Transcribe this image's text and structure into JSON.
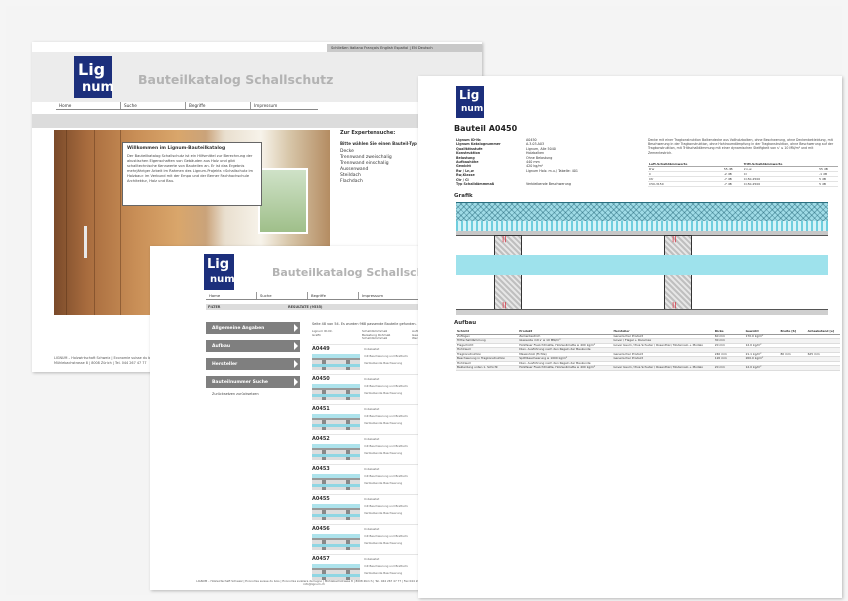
{
  "window_a": {
    "lang_bar": "Schließen   Italiano  Français  English  Español  |  EN  Deutsch",
    "title": "Bauteilkatalog Schallschutz",
    "nav": [
      "Home",
      "Suche",
      "Begriffe",
      "Impressum"
    ],
    "welcome_title": "Willkommen im Lignum-Bauteilkatalog",
    "welcome_body": "Der Bauteilkatalog Schallschutz ist ein Hilfsmittel zur Berechnung der akustischen Eigenschaften von Gebäuden aus Holz und gibt schalltechnische Kennwerte von Bauteilen an. Er ist das Ergebnis mehrjähriger Arbeit im Rahmen des Lignum-Projekts «Schallschutz im Holzbau» im Verbund mit der Empa und der Berner Fachhochschule Architektur, Holz und Bau.",
    "expert_title": "Zur Expertensuche:",
    "expert_prompt": "Bitte wählen Sie einen Bauteil-Typ aus:",
    "types": [
      "Decke",
      "Trennwand zweischalig",
      "Trennwand einschalig",
      "Aussenwand",
      "Steildach",
      "Flachdach"
    ],
    "footer": "LIGNUM – Holzwirtschaft Schweiz | Economie suisse du bois | Mühlebachstrasse 8 | 8008 Zürich | Tel. 044 267 47 77"
  },
  "window_b": {
    "title": "Bauteilkatalog Schallschutz",
    "nav": [
      "Home",
      "Suche",
      "Begriffe",
      "Impressum"
    ],
    "filter_label": "FILTER",
    "results_label": "RESULTATE (9535)",
    "side_buttons": [
      "Allgemeine Angaben",
      "Aufbau",
      "Hersteller",
      "Bauteilnummer Suche"
    ],
    "reset_link": "Zurücksetzen zurücksetzen",
    "results_caption": "Seite 48 von 54. Es wurden 968 passende Bauteile gefunden.",
    "col_heads": [
      "Lignum ID-Nr. Grafik",
      "Schalldämmmaß Belastung Rohmaß Schalldämmmaß",
      "Aufbauten Gewicht in Werten"
    ],
    "items": [
      "A0449",
      "A0450",
      "A0451",
      "A0452",
      "A0453",
      "A0455",
      "A0456",
      "A0457"
    ],
    "row_texts": [
      "Unbelastet",
      "mit Beschwerung und Brettschalung",
      "Verbleibende Beschwerung"
    ],
    "footer": "LIGNUM – Holzwirtschaft Schweiz | Economie suisse du bois | Economia svizzera del legno | Mühlebachstrasse 8 | 8008 Zürich | Tel. 044 267 47 77 | Fax 044 267 47 87 | info@lignum.ch"
  },
  "window_c": {
    "title": "Bauteil A0450",
    "props_labels": [
      "Lignum ID-Nr.",
      "Lignum Katalognummer",
      "Qualitätsstufe",
      "Konstruktion",
      "Belastung",
      "Aufbauhöhe",
      "Gewicht",
      "Rw / Ln,w",
      "Rw,Klasse",
      "Ctr / Cl",
      "Typ Schalldämmmaß"
    ],
    "props_values": [
      "A0450",
      "A.3.03.A03",
      "Lignum, Alle 5040",
      "Holzbalken",
      "Ohne Belastung",
      "440 mm",
      "420 kg/m²",
      "Lignum Holz. m.u./ Tabelle: 401",
      "",
      "",
      "Verbleibende Beschwerung"
    ],
    "description": "Decke mit einer Tragkonstruktion Balkendecke aus Vollholzbalken, ohne Beschwerung, ohne Deckenbekleidung, mit Beschwerung in der Tragkonstruktion, ohne Hohlraumdämpfung in der Tragkonstruktion, ohne Beschwerung auf der Tragkonstruktion, mit Trittschalldämmung mit einer dynamischen Steifigkeit von s' ≤ 10 MN/m³ und mit Zementestrich.",
    "t1_head": [
      "Luft-Schalldämmwerte",
      "",
      "Tritt-Schalldämmwerte",
      ""
    ],
    "t1_rows": [
      [
        "R'w",
        "55 dB",
        "L'n,w",
        "55 dB"
      ],
      [
        "C",
        "-2 dB",
        "Cl",
        "-1 dB"
      ],
      [
        "Ctr",
        "-7 dB",
        "Cl,50-2500",
        "5 dB"
      ],
      [
        "C50-3150",
        "-7 dB",
        "Cl,50-2500",
        "5 dB"
      ]
    ],
    "graphic_label": "Grafik",
    "build_label": "Aufbau",
    "build_head": [
      "Schicht",
      "Produkt",
      "Hersteller",
      "Dicke",
      "Gewicht",
      "Breite [S]",
      "Achsabstand [e]"
    ],
    "build_rows": [
      [
        "Zuflügen",
        "Zementestrich",
        "Generischer Produkt",
        "60 mm",
        "170.0 kg/m²",
        "",
        ""
      ],
      [
        "Trittschalldämmung",
        "Glaswolle mit s' ≤ 10 MN/m³",
        "Isover / Flagel + Roosmax",
        "30 mm",
        "",
        "",
        ""
      ],
      [
        "Flagschicht",
        "Holzfaser Flexichtmatte, Holzwollmatte ≥ 400 kg/m³",
        "Isover Issum / Piva Schuder / Rosenthal / Modernalo + Modalo",
        "20 mm",
        "12.0 kg/m²",
        "",
        ""
      ],
      [
        "Hohlraum",
        "Dien. Ausführung nach den Regeln der Baukunde",
        "",
        "",
        "",
        "",
        ""
      ],
      [
        "Tragkonstruktion",
        "Massivholz (Fichte)",
        "Generischer Produkt",
        "240 mm",
        "21.1 kg/m²",
        "80 mm",
        "625 mm"
      ],
      [
        "Beschwerung in Tragkonstruktion",
        "Splittbeschwerung ≥ 1000 kg/m³",
        "Generischer Produkt",
        "120 mm",
        "200.0 kg/m²",
        "",
        ""
      ],
      [
        "Hohlraum",
        "Dien. Ausführung nach den Regeln der Baukunde",
        "",
        "",
        "",
        "",
        ""
      ],
      [
        "Bekleidung unten 1. Schicht",
        "Holzfaser Flexichtmatte, Holzwollmatte ≥ 400 kg/m³",
        "Isover Issum / Piva Schuder / Rosenthal / Modernalo + Modalo",
        "20 mm",
        "12.0 kg/m²",
        "",
        ""
      ]
    ]
  }
}
